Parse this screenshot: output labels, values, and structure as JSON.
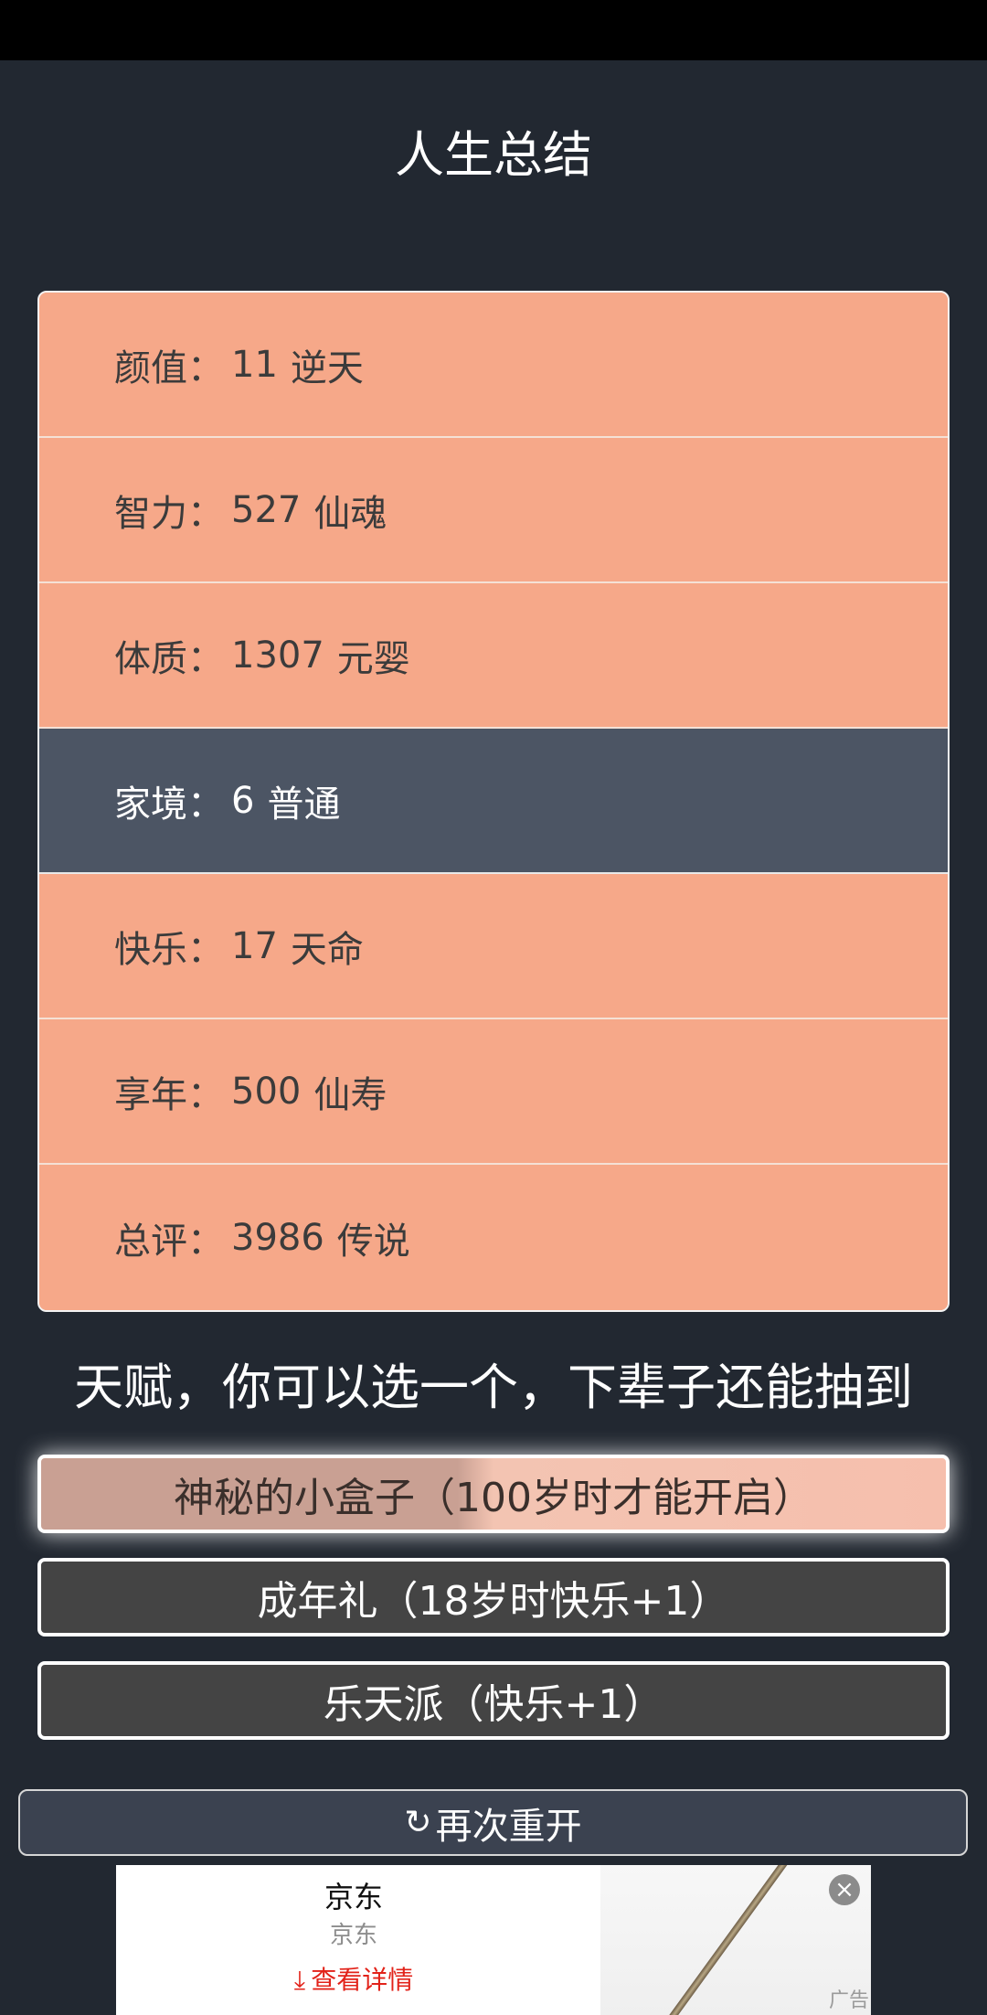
{
  "title": "人生总结",
  "stats": [
    {
      "label": "颜值",
      "value": "11",
      "rank": "逆天",
      "highlight": false
    },
    {
      "label": "智力",
      "value": "527",
      "rank": "仙魂",
      "highlight": false
    },
    {
      "label": "体质",
      "value": "1307",
      "rank": "元婴",
      "highlight": false
    },
    {
      "label": "家境",
      "value": "6",
      "rank": "普通",
      "highlight": true
    },
    {
      "label": "快乐",
      "value": "17",
      "rank": "天命",
      "highlight": false
    },
    {
      "label": "享年",
      "value": "500",
      "rank": "仙寿",
      "highlight": false
    },
    {
      "label": "总评",
      "value": "3986",
      "rank": "传说",
      "highlight": false
    }
  ],
  "stat_separator": "：",
  "talent_prompt": "天赋，你可以选一个，下辈子还能抽到",
  "talents": [
    {
      "label": "神秘的小盒子（100岁时才能开启）",
      "selected": true
    },
    {
      "label": "成年礼（18岁时快乐+1）",
      "selected": false
    },
    {
      "label": "乐天派（快乐+1）",
      "selected": false
    }
  ],
  "restart": {
    "icon": "refresh-icon",
    "label": "再次重开"
  },
  "ad": {
    "brand": "京东",
    "brand_sub": "京东",
    "details_label": "查看详情",
    "details_icon": "download-arrow-icon",
    "close_icon": "close-icon",
    "tag": "广告"
  },
  "colors": {
    "background": "#222831",
    "stat_row": "#f6a889",
    "stat_row_highlight": "#4c5564",
    "talent_button": "#444444",
    "restart_button": "#3b4250",
    "ad_link": "#e2231a"
  }
}
